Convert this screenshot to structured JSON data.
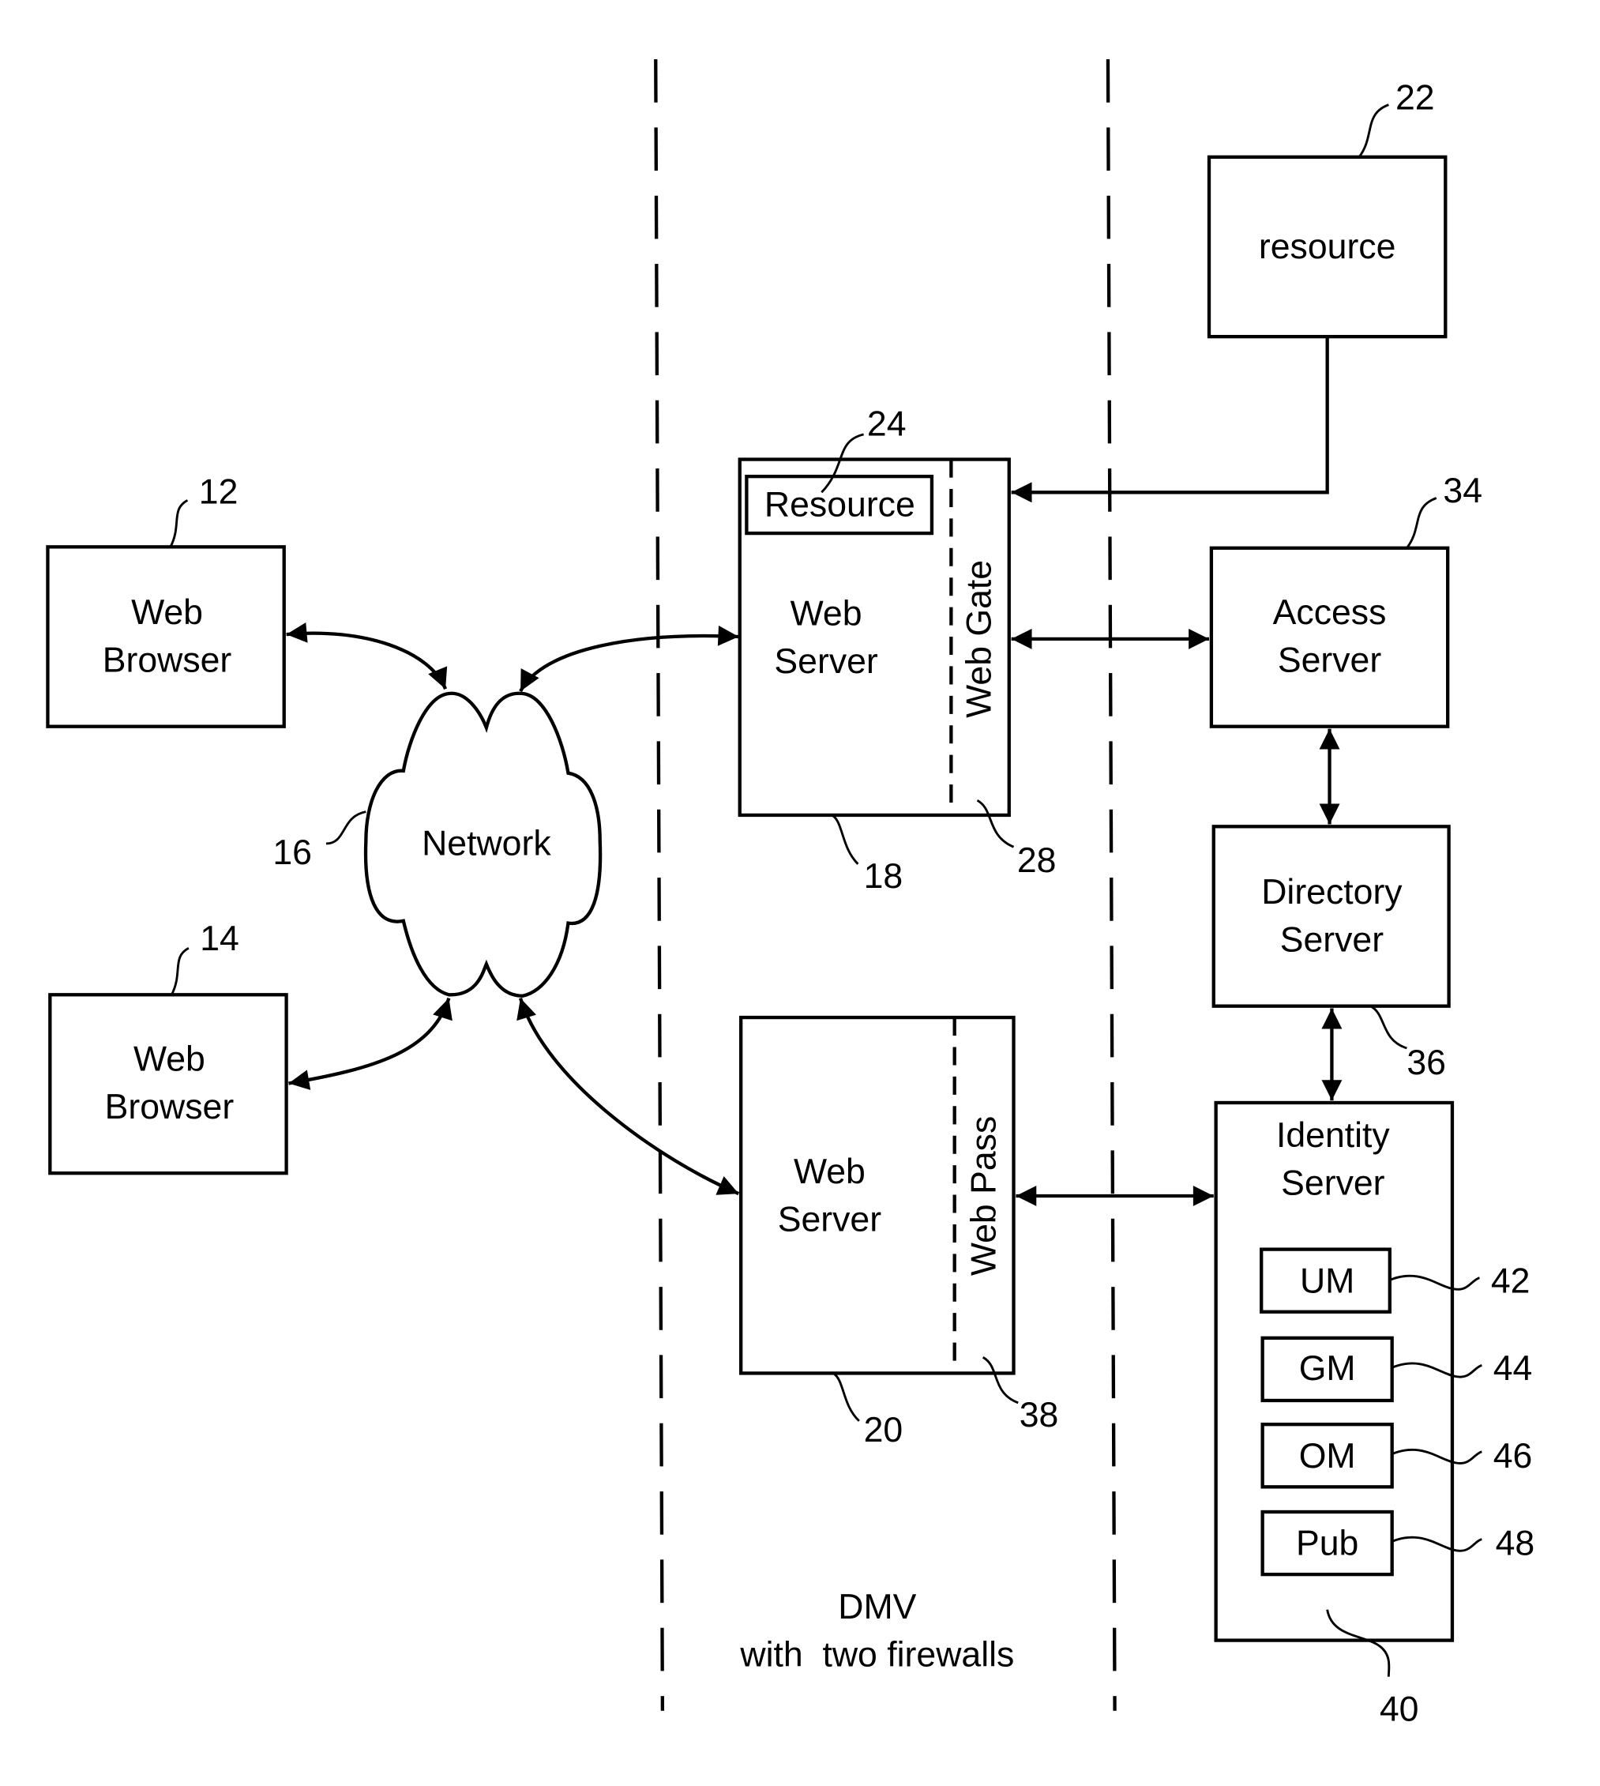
{
  "diagram": {
    "firewall_caption": {
      "line1": "DMV",
      "line2": "with  two firewalls"
    },
    "nodes": {
      "browser1": {
        "line1": "Web",
        "line2": "Browser",
        "ref": "12"
      },
      "browser2": {
        "line1": "Web",
        "line2": "Browser",
        "ref": "14"
      },
      "network": {
        "label": "Network",
        "ref": "16"
      },
      "webserver1": {
        "line1": "Web",
        "line2": "Server",
        "ref": "18"
      },
      "resource_inner": {
        "label": "Resource",
        "ref": "24"
      },
      "webgate": {
        "label": "Web Gate",
        "ref": "28"
      },
      "webserver2": {
        "line1": "Web",
        "line2": "Server",
        "ref": "20"
      },
      "webpass": {
        "label": "Web Pass",
        "ref": "38"
      },
      "resource_ext": {
        "label": "resource",
        "ref": "22"
      },
      "access_server": {
        "line1": "Access",
        "line2": "Server",
        "ref": "34"
      },
      "directory_server": {
        "line1": "Directory",
        "line2": "Server",
        "ref": "36"
      },
      "identity_server": {
        "line1": "Identity",
        "line2": "Server",
        "ref": "40"
      },
      "um": {
        "label": "UM",
        "ref": "42"
      },
      "gm": {
        "label": "GM",
        "ref": "44"
      },
      "om": {
        "label": "OM",
        "ref": "46"
      },
      "pub": {
        "label": "Pub",
        "ref": "48"
      }
    }
  }
}
